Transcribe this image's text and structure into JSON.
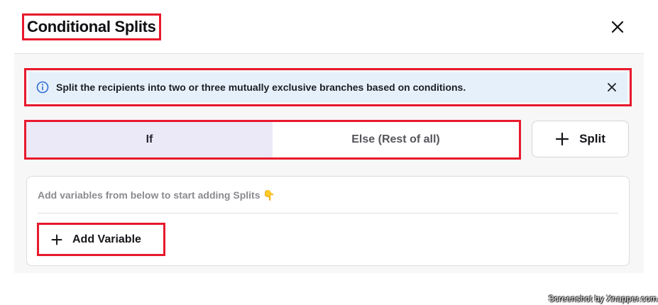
{
  "header": {
    "title": "Conditional Splits",
    "close_icon": "close-icon"
  },
  "info_banner": {
    "text": "Split the recipients into two or three mutually exclusive branches based on conditions.",
    "icon": "info-icon",
    "close_icon": "close-icon"
  },
  "tabs": [
    {
      "label": "If",
      "active": true
    },
    {
      "label": "Else (Rest of all)",
      "active": false
    }
  ],
  "split_button": {
    "label": "Split",
    "icon": "plus-icon"
  },
  "variables_card": {
    "hint": "Add variables from below to start adding Splits 👇",
    "add_variable_label": "Add Variable",
    "add_icon": "plus-icon"
  },
  "watermark": "Screenshot by Xnapper.com",
  "colors": {
    "highlight_border": "#e8192c",
    "info_bg": "#e6f0fb",
    "info_icon": "#2f6fd6",
    "active_tab_bg": "#ebe9f8"
  }
}
